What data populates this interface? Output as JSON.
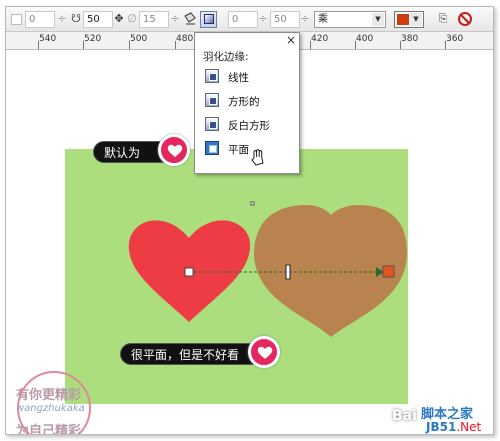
{
  "toolbar": {
    "field1": "0",
    "field2": "50",
    "field3": "15",
    "field4": "0",
    "field5": "50",
    "merge_mode": "乘"
  },
  "ruler": {
    "labels": [
      "540",
      "520",
      "500",
      "480",
      "420",
      "400",
      "380",
      "360"
    ]
  },
  "popup": {
    "title": "羽化边缘:",
    "close": "×",
    "items": [
      {
        "label": "线性",
        "selected": false
      },
      {
        "label": "方形的",
        "selected": false
      },
      {
        "label": "反白方形",
        "selected": false
      },
      {
        "label": "平面",
        "selected": true
      }
    ]
  },
  "callouts": {
    "default": "默认为",
    "flat": "很平面，但是不好看"
  },
  "watermarks": {
    "stamp_line1": "有你更精彩",
    "stamp_line2": "wangzhukaka",
    "stamp_line3": "为自己精彩",
    "bai": "Bai",
    "jb_name": "脚本之家",
    "jb_url_left": "JB51",
    "jb_url_right": ".Net"
  },
  "colors": {
    "canvas_green": "#acde7d",
    "red_heart": "#ee3c45",
    "brown_heart": "#b9834f",
    "badge_pink": "#e5265f",
    "swatch_red": "#d03c10"
  }
}
